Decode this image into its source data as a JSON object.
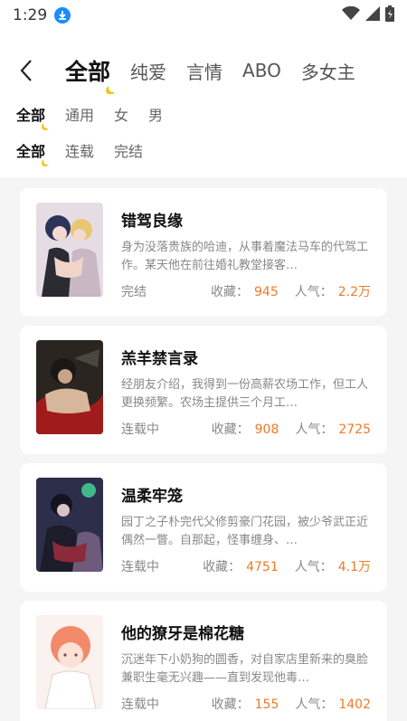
{
  "status_bar": {
    "time": "1:29"
  },
  "nav": {
    "tabs": [
      "全部",
      "纯爱",
      "言情",
      "ABO",
      "多女主"
    ],
    "active_index": 0
  },
  "filters": {
    "audience": {
      "options": [
        "全部",
        "通用",
        "女",
        "男"
      ],
      "active_index": 0
    },
    "progress": {
      "options": [
        "全部",
        "连载",
        "完结"
      ],
      "active_index": 0
    }
  },
  "stats_labels": {
    "fav": "收藏：",
    "pop": "人气："
  },
  "books": [
    {
      "title": "错驾良缘",
      "desc": "身为没落贵族的哈迪，从事着魔法马车的代驾工作。某天他在前往婚礼教堂接客…",
      "status": "完结",
      "fav": "945",
      "pop": "2.2万"
    },
    {
      "title": "羔羊禁言录",
      "desc": "经朋友介绍，我得到一份高薪农场工作，但工人更换频繁。农场主提供三个月工…",
      "status": "连载中",
      "fav": "908",
      "pop": "2725"
    },
    {
      "title": "温柔牢笼",
      "desc": "园丁之子朴完代父修剪豪门花园，被少爷武正近偶然一瞥。自那起，怪事缠身、…",
      "status": "连载中",
      "fav": "4751",
      "pop": "4.1万"
    },
    {
      "title": "他的獠牙是棉花糖",
      "desc": "沉迷年下小奶狗的圆香，对自家店里新来的臭脸兼职生毫无兴趣——直到发现他毒…",
      "status": "连载中",
      "fav": "155",
      "pop": "1402"
    }
  ]
}
